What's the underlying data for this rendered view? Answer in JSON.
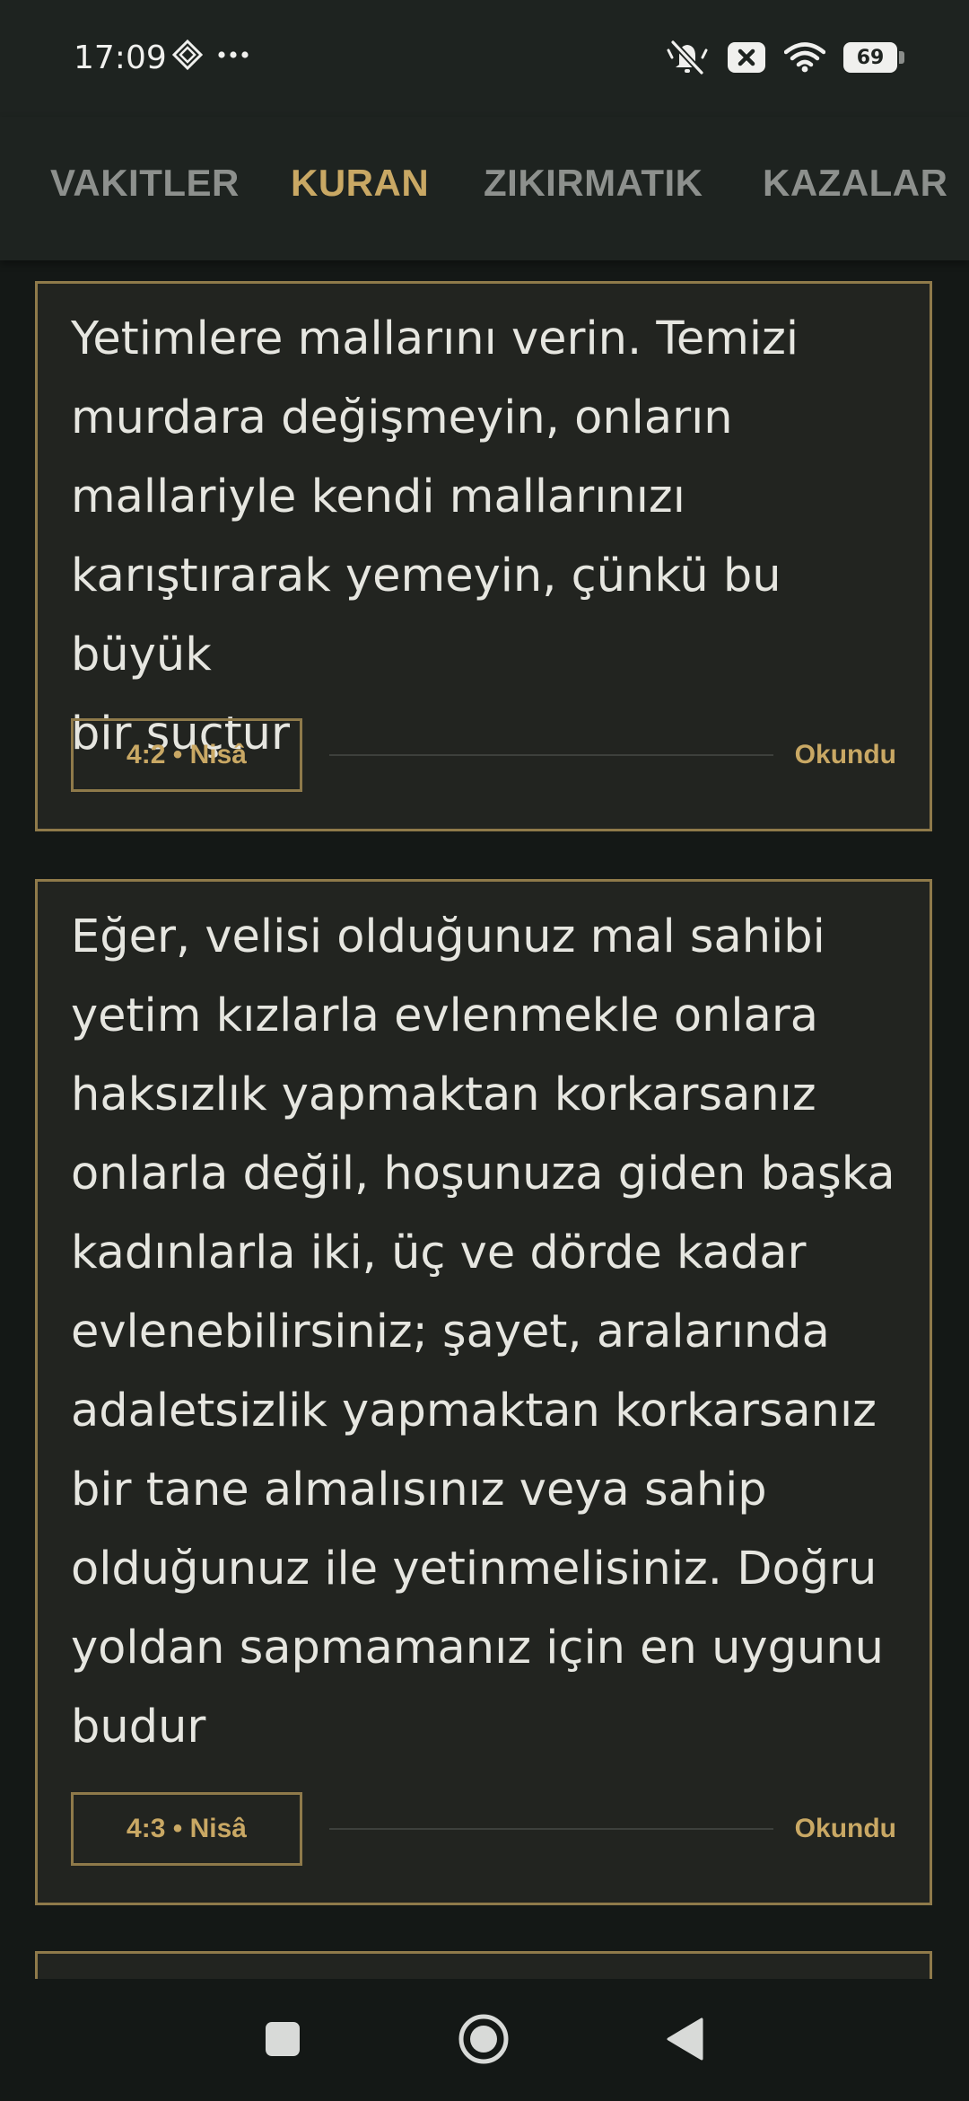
{
  "status_bar": {
    "time": "17:09",
    "battery_level": "69",
    "icons": [
      "navigation-diamond-icon",
      "more-dots-icon",
      "bell-off-icon",
      "close-box-icon",
      "wifi-icon",
      "battery-icon"
    ]
  },
  "tabs": [
    {
      "label": "VAKITLER",
      "active": false
    },
    {
      "label": "KURAN",
      "active": true
    },
    {
      "label": "ZIKIRMATIK",
      "active": false
    },
    {
      "label": "KAZALAR",
      "active": false
    }
  ],
  "verses": [
    {
      "lines": [
        "Yetimlere mallarını verin. Temizi",
        "murdara değişmeyin, onların",
        "mallariyle kendi mallarınızı",
        "karıştırarak yemeyin, çünkü bu büyük",
        "bir suçtur"
      ],
      "reference": "4:2 • Nisâ",
      "action": "Okundu"
    },
    {
      "lines": [
        "Eğer, velisi olduğunuz mal sahibi",
        "yetim kızlarla evlenmekle onlara",
        "haksızlık yapmaktan korkarsanız",
        "onlarla değil, hoşunuza giden başka",
        "kadınlarla iki, üç ve dörde kadar",
        "evlenebilirsiniz; şayet, aralarında",
        "adaletsizlik yapmaktan korkarsanız",
        "bir tane almalısınız veya sahip",
        "olduğunuz ile yetinmelisiniz. Doğru",
        "yoldan sapmamanız için en uygunu",
        "budur"
      ],
      "reference": "4:3 • Nisâ",
      "action": "Okundu"
    }
  ],
  "nav_bar": {
    "icons": [
      "recents-square-icon",
      "home-circle-icon",
      "back-triangle-icon"
    ]
  },
  "colors": {
    "accent": "#c9a864",
    "card_border": "#8f7a4a",
    "card_background": "#222420",
    "bar_background": "#1e2320",
    "page_background": "#141816",
    "inactive_tab": "#8d908d"
  }
}
